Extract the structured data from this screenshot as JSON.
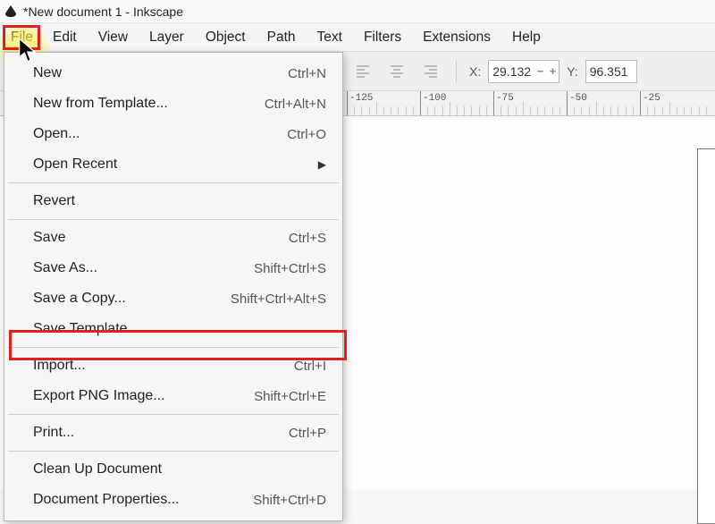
{
  "title": "*New document 1 - Inkscape",
  "menubar": [
    "File",
    "Edit",
    "View",
    "Layer",
    "Object",
    "Path",
    "Text",
    "Filters",
    "Extensions",
    "Help"
  ],
  "toolbar": {
    "x_label": "X:",
    "x_value": "29.132",
    "y_label": "Y:",
    "y_value": "96.351"
  },
  "ruler_ticks": [
    "-125",
    "-100",
    "-75",
    "-50",
    "-25"
  ],
  "file_menu": [
    {
      "label": "New",
      "shortcut": "Ctrl+N",
      "name": "menu-new"
    },
    {
      "label": "New from Template...",
      "shortcut": "Ctrl+Alt+N",
      "name": "menu-new-template"
    },
    {
      "label": "Open...",
      "shortcut": "Ctrl+O",
      "name": "menu-open"
    },
    {
      "label": "Open Recent",
      "submenu": true,
      "name": "menu-open-recent"
    },
    {
      "sep": true
    },
    {
      "label": "Revert",
      "name": "menu-revert"
    },
    {
      "sep": true
    },
    {
      "label": "Save",
      "shortcut": "Ctrl+S",
      "name": "menu-save"
    },
    {
      "label": "Save As...",
      "shortcut": "Shift+Ctrl+S",
      "name": "menu-save-as"
    },
    {
      "label": "Save a Copy...",
      "shortcut": "Shift+Ctrl+Alt+S",
      "name": "menu-save-copy"
    },
    {
      "label": "Save Template...",
      "name": "menu-save-template"
    },
    {
      "sep": true
    },
    {
      "label": "Import...",
      "shortcut": "Ctrl+I",
      "name": "menu-import"
    },
    {
      "label": "Export PNG Image...",
      "shortcut": "Shift+Ctrl+E",
      "name": "menu-export-png"
    },
    {
      "sep": true
    },
    {
      "label": "Print...",
      "shortcut": "Ctrl+P",
      "name": "menu-print"
    },
    {
      "sep": true
    },
    {
      "label": "Clean Up Document",
      "name": "menu-cleanup"
    },
    {
      "label": "Document Properties...",
      "shortcut": "Shift+Ctrl+D",
      "name": "menu-doc-props"
    }
  ]
}
